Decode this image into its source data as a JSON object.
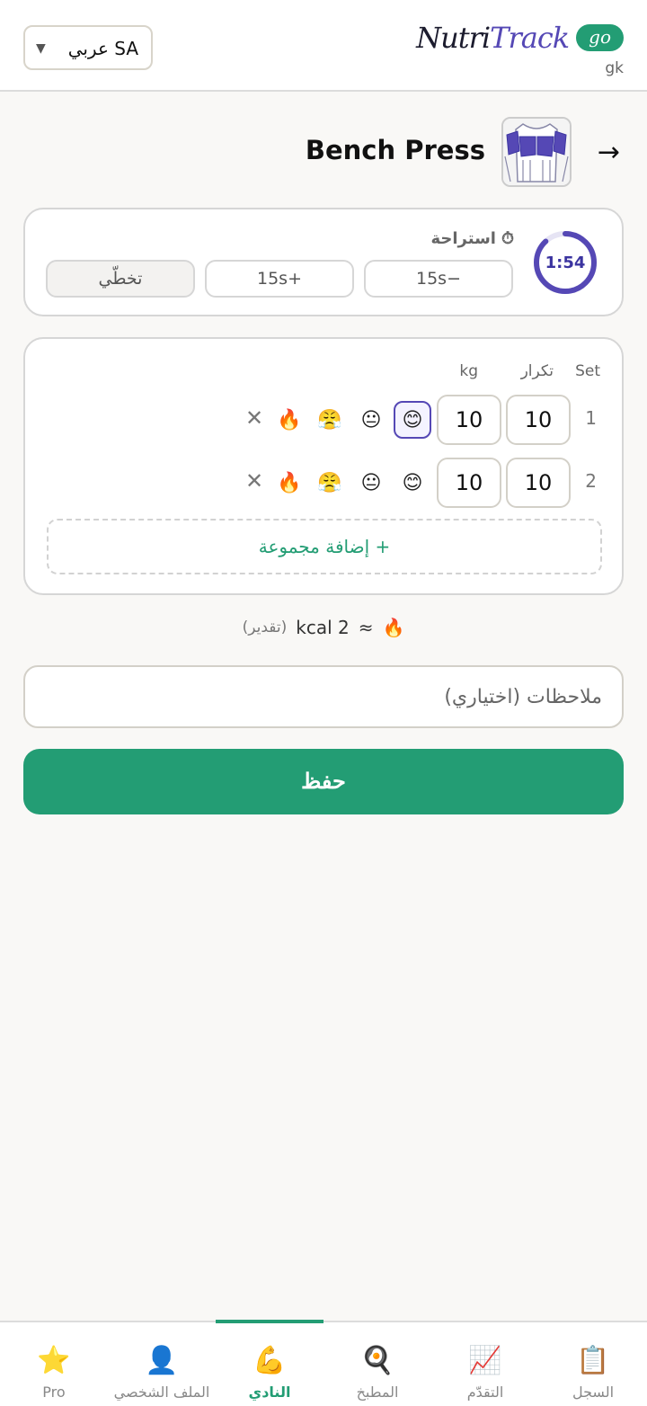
{
  "header": {
    "language_label": "SA عربي",
    "language_arrow": "▼",
    "brand_nutri": "Nutri",
    "brand_track": "Track",
    "brand_badge": "go",
    "user_initials": "gk"
  },
  "exercise": {
    "title": "Bench Press",
    "back_arrow": "→"
  },
  "rest": {
    "label": "استراحة",
    "timer_icon": "⏱",
    "timer": "1:54",
    "timer_progress": 0.88,
    "minus_label": "15s−",
    "plus_label": "15s+",
    "skip_label": "تخطّي"
  },
  "sets": {
    "col_set": "Set",
    "col_reps": "تكرار",
    "col_kg": "kg",
    "rows": [
      {
        "num": "1",
        "reps": "10",
        "kg": "10",
        "selected_mood": 0
      },
      {
        "num": "2",
        "reps": "10",
        "kg": "10",
        "selected_mood": null
      }
    ],
    "moods": [
      "😊",
      "😐",
      "😤",
      "🔥"
    ],
    "remove_icon": "✕",
    "add_label": "+ إضافة مجموعة"
  },
  "kcal": {
    "icon": "🔥",
    "approx": "≈",
    "value": "kcal 2",
    "hint": "(تقدير)"
  },
  "notes": {
    "placeholder": "ملاحظات (اختياري)",
    "value": ""
  },
  "save_label": "حفظ",
  "nav": [
    {
      "label": "Pro",
      "icon": "⭐"
    },
    {
      "label": "الملف الشخصي",
      "icon": "👤"
    },
    {
      "label": "النادي",
      "icon": "💪"
    },
    {
      "label": "المطبخ",
      "icon": "🍳"
    },
    {
      "label": "التقدّم",
      "icon": "📈"
    },
    {
      "label": "السجل",
      "icon": "📋"
    }
  ],
  "colors": {
    "accent": "#239d74",
    "brand": "#5548b5"
  }
}
